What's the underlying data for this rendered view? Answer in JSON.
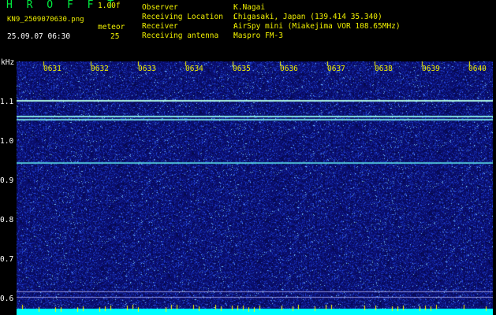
{
  "header": {
    "brand": "H R O F F T",
    "version": "1.00f",
    "filename": "KN9_2509070630.png",
    "datetime": "25.09.07 06:30",
    "meteor_label": "meteor",
    "meteor_count": "25"
  },
  "info": {
    "observer_label": "Observer            : ",
    "observer_value": "K.Nagai",
    "location_label": "Receiving Location  : ",
    "location_value": "Chigasaki, Japan (139.414 35.340)",
    "receiver_label": "Receiver            : ",
    "receiver_value": "AirSpy mini (Miakejima VOR 108.65MHz)",
    "antenna_label": "Receiving antenna   : ",
    "antenna_value": "Maspro FM-3"
  },
  "axis": {
    "y_unit": "kHz",
    "y_ticks": [
      "1.1",
      "1.0",
      "0.9",
      "0.8",
      "0.7",
      "0.6"
    ],
    "x_ticks": [
      "0631",
      "0632",
      "0633",
      "0634",
      "0635",
      "0636",
      "0637",
      "0638",
      "0639",
      "0640"
    ]
  },
  "colors": {
    "background": "#000000",
    "noise_base": "#101080",
    "noise_bright": "#3050ff",
    "carrier": "#a0ffe0",
    "bottom_band": "#00ffff",
    "tick_marks": "#ffff00",
    "text_white": "#ffffff",
    "text_yellow": "#f0f000",
    "text_green": "#00ee40"
  }
}
